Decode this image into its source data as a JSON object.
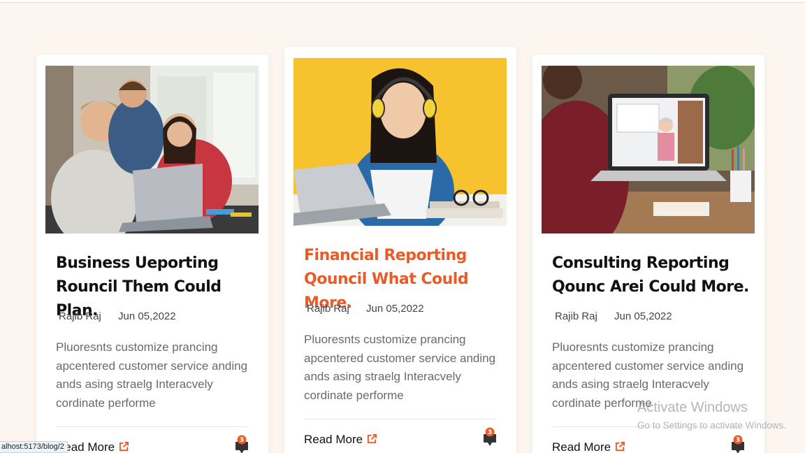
{
  "posts": [
    {
      "image_desc": "three-students-laptop-photo",
      "title": "Business Ueporting Rouncil Them Could Plan.",
      "author": "Rajib Raj",
      "date": "Jun 05,2022",
      "excerpt": "Pluoresnts customize prancing apcentered customer service anding ands asing straelg Interacvely cordinate performe",
      "read_more": "Read More",
      "comments": "3"
    },
    {
      "image_desc": "student-headphones-laptop-photo",
      "title": "Financial Reporting Qouncil What Could More.",
      "author": "Rajib Raj",
      "date": "Jun 05,2022",
      "excerpt": "Pluoresnts customize prancing apcentered customer service anding ands asing straelg Interacvely cordinate performe",
      "read_more": "Read More",
      "comments": "3"
    },
    {
      "image_desc": "online-class-laptop-photo",
      "title": "Consulting Reporting Qounc Arei Could More.",
      "author": "Rajib Raj",
      "date": "Jun 05,2022",
      "excerpt": "Pluoresnts customize prancing apcentered customer service anding ands asing straelg Interacvely cordinate performe",
      "read_more": "Read More",
      "comments": "3"
    }
  ],
  "status_url": "alhost:5173/blog/2",
  "watermark": {
    "title": "Activate Windows",
    "subtitle": "Go to Settings to activate Windows."
  },
  "colors": {
    "accent": "#ea5b2a",
    "page_bg": "#fdf6f0",
    "badge": "#ea5b2a"
  }
}
